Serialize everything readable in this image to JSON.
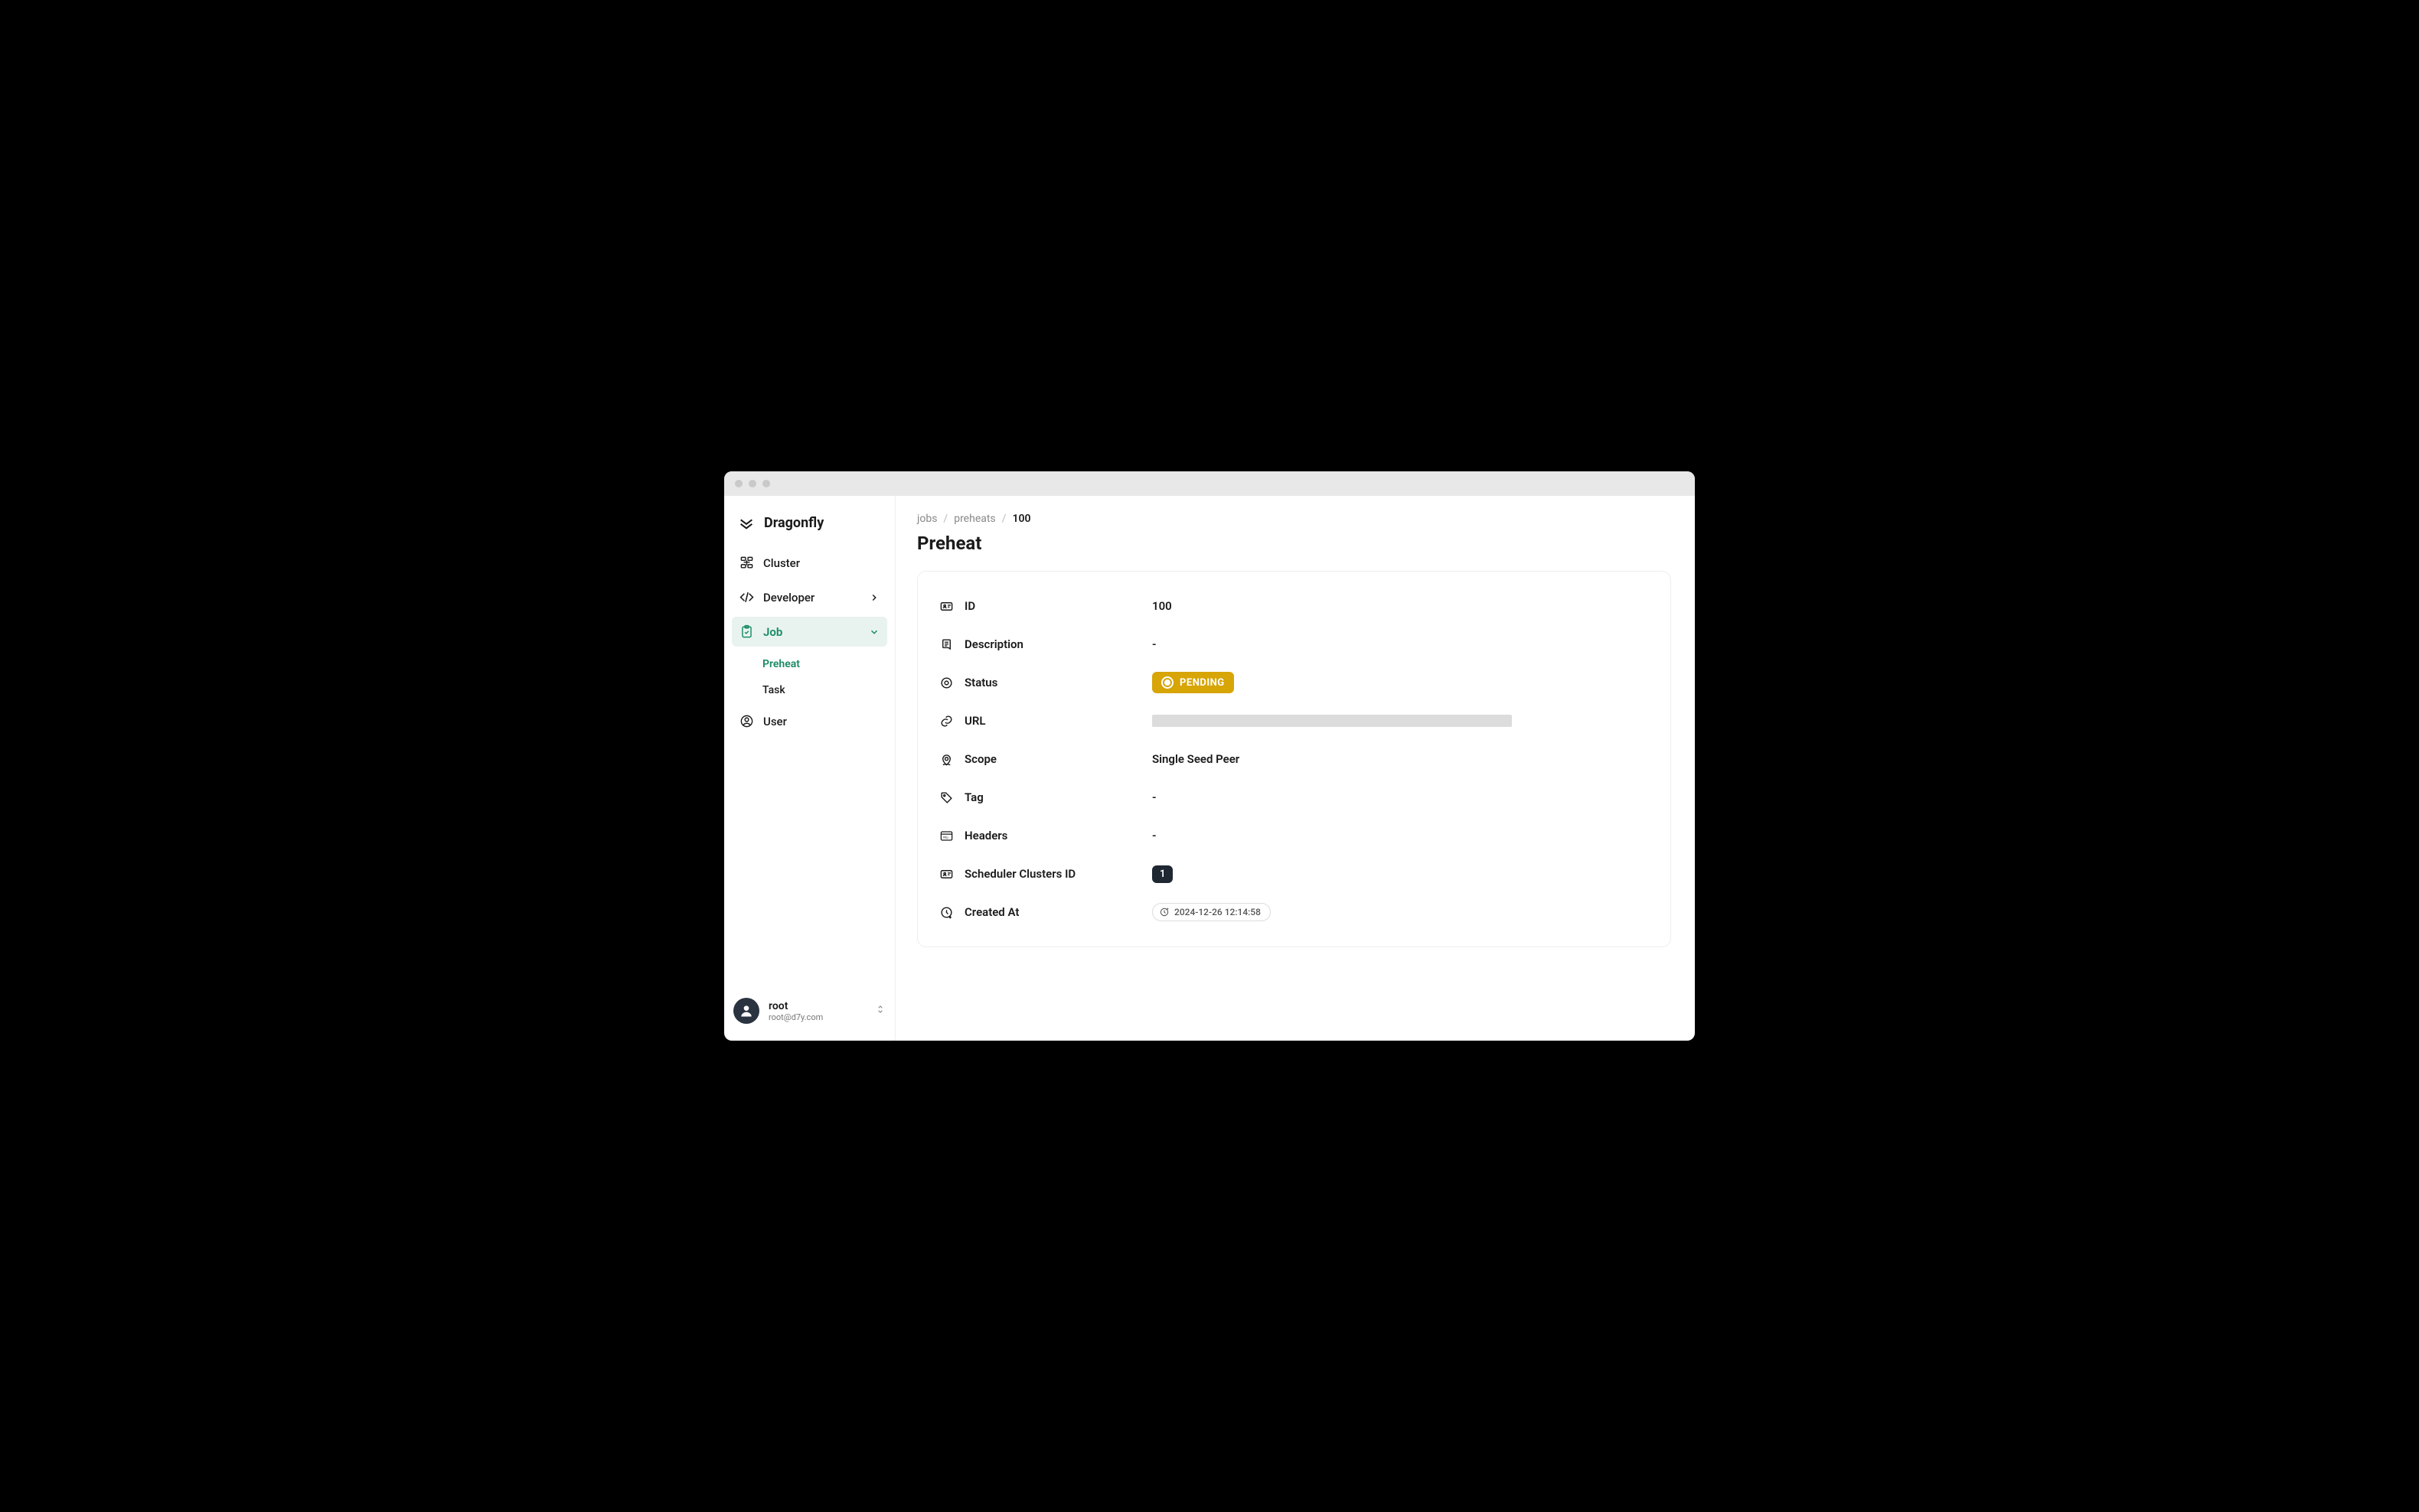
{
  "brand": {
    "name": "Dragonfly"
  },
  "sidebar": {
    "cluster": "Cluster",
    "developer": "Developer",
    "job": "Job",
    "job_children": {
      "preheat": "Preheat",
      "task": "Task"
    },
    "user": "User"
  },
  "footer": {
    "username": "root",
    "email": "root@d7y.com"
  },
  "breadcrumb": {
    "jobs": "jobs",
    "preheats": "preheats",
    "id": "100"
  },
  "page": {
    "title": "Preheat"
  },
  "details": {
    "labels": {
      "id": "ID",
      "description": "Description",
      "status": "Status",
      "url": "URL",
      "scope": "Scope",
      "tag": "Tag",
      "headers": "Headers",
      "scheduler": "Scheduler Clusters ID",
      "created": "Created At"
    },
    "values": {
      "id": "100",
      "description": "-",
      "status": "PENDING",
      "scope": "Single Seed Peer",
      "tag": "-",
      "headers": "-",
      "scheduler": "1",
      "created": "2024-12-26 12:14:58"
    }
  }
}
